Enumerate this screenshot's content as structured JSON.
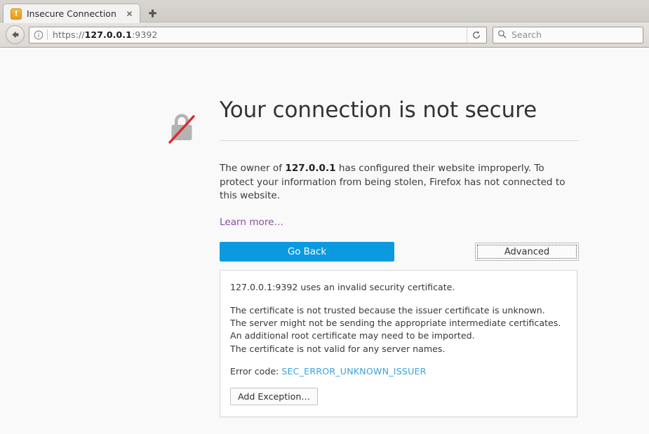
{
  "browser": {
    "tab": {
      "title": "Insecure Connection",
      "favicon_icon": "warning-exclamation-icon",
      "close_icon": "close-icon"
    },
    "new_tab_icon": "plus-icon",
    "back_icon": "back-arrow-icon",
    "identity_icon": "info-circle-icon",
    "reload_icon": "reload-icon",
    "url": {
      "scheme": "https://",
      "host": "127.0.0.1",
      "port": ":9392"
    },
    "search": {
      "icon": "search-icon",
      "placeholder": "Search"
    }
  },
  "error_page": {
    "lock_icon": "broken-lock-icon",
    "title": "Your connection is not secure",
    "description_prefix": "The owner of ",
    "description_host": "127.0.0.1",
    "description_suffix": " has configured their website improperly. To protect your information from being stolen, Firefox has not connected to this website.",
    "learn_more": "Learn more…",
    "go_back_label": "Go Back",
    "advanced_label": "Advanced",
    "accent_color": "#0b9ae0",
    "link_color": "#8a4ba3",
    "error_code_color": "#3aa3dc"
  },
  "cert_panel": {
    "summary": "127.0.0.1:9392 uses an invalid security certificate.",
    "reasons": [
      "The certificate is not trusted because the issuer certificate is unknown.",
      "The server might not be sending the appropriate intermediate certificates.",
      "An additional root certificate may need to be imported.",
      "The certificate is not valid for any server names."
    ],
    "error_code_label": "Error code: ",
    "error_code": "SEC_ERROR_UNKNOWN_ISSUER",
    "add_exception_label": "Add Exception…"
  }
}
